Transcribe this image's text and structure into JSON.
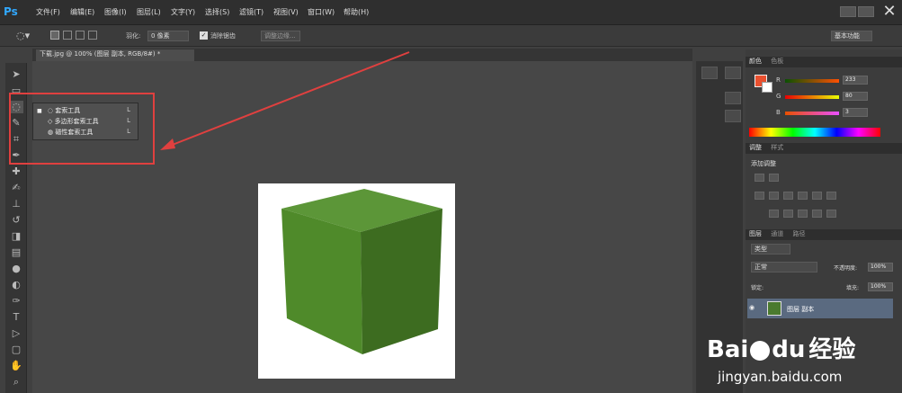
{
  "app": {
    "logo": "Ps"
  },
  "menus": [
    "文件(F)",
    "编辑(E)",
    "图像(I)",
    "图层(L)",
    "文字(Y)",
    "选择(S)",
    "滤镜(T)",
    "视图(V)",
    "窗口(W)",
    "帮助(H)"
  ],
  "options": {
    "feather_label": "羽化:",
    "feather_value": "0 像素",
    "antialias_label": "消除锯齿",
    "refine_label": "调整边缘...",
    "workspace": "基本功能"
  },
  "document_tab": {
    "title": "下载.jpg @ 100% (图层 副本, RGB/8#) *",
    "close": "×"
  },
  "flyout": {
    "items": [
      {
        "label": "套索工具",
        "key": "L",
        "marker": "■"
      },
      {
        "label": "多边形套索工具",
        "key": "L",
        "marker": ""
      },
      {
        "label": "磁性套索工具",
        "key": "L",
        "marker": ""
      }
    ]
  },
  "panels": {
    "color_tab": "颜色",
    "swatches_tab": "色板",
    "r_label": "R",
    "g_label": "G",
    "b_label": "B",
    "r_value": "233",
    "g_value": "80",
    "b_value": "3",
    "adjust_tab": "调整",
    "styles_tab": "样式",
    "add_adjust": "添加调整",
    "layers_tab": "图层",
    "channels_tab": "通道",
    "paths_tab": "路径",
    "kind": "类型",
    "blend": "正常",
    "opacity_label": "不透明度:",
    "opacity_value": "100%",
    "lock_label": "锁定:",
    "fill_label": "填充:",
    "fill_value": "100%",
    "layer_name": "图层 副本"
  },
  "watermark": {
    "brand_a": "Bai",
    "brand_b": "du",
    "brand_cn": "经验",
    "url": "jingyan.baidu.com"
  },
  "colors": {
    "accent": "#e0403f",
    "cube_top": "#5a8f37",
    "cube_left": "#4f8a2a",
    "cube_right": "#3f6f22",
    "foreground": "#e9502f"
  }
}
